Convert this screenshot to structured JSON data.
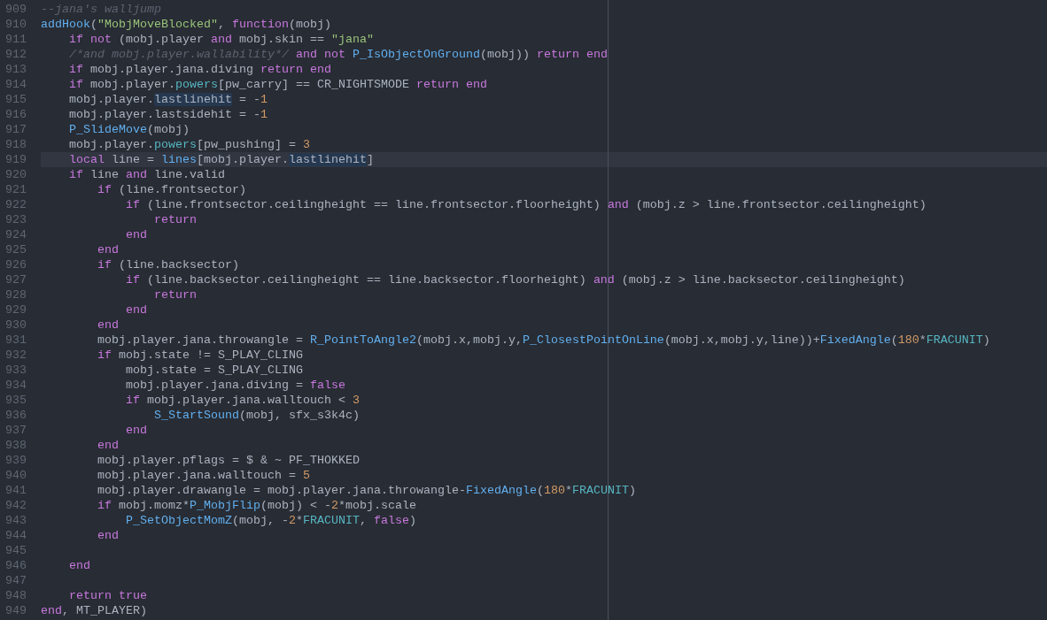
{
  "editor": {
    "lines": [
      {
        "number": "909",
        "current": false,
        "tokens": [
          {
            "text": "--jana's walljump",
            "kind": "comment"
          }
        ]
      },
      {
        "number": "910",
        "current": false,
        "tokens": [
          {
            "text": "addHook",
            "kind": "function"
          },
          {
            "text": "(",
            "kind": "plain"
          },
          {
            "text": "\"MobjMoveBlocked\"",
            "kind": "string"
          },
          {
            "text": ", ",
            "kind": "plain"
          },
          {
            "text": "function",
            "kind": "keyword"
          },
          {
            "text": "(mobj)",
            "kind": "plain"
          }
        ]
      },
      {
        "number": "911",
        "current": false,
        "tokens": [
          {
            "text": "    if ",
            "kind": "keyword"
          },
          {
            "text": "not",
            "kind": "keyword"
          },
          {
            "text": " (mobj.player ",
            "kind": "plain"
          },
          {
            "text": "and",
            "kind": "keyword"
          },
          {
            "text": " mobj.skin == ",
            "kind": "plain"
          },
          {
            "text": "\"jana\"",
            "kind": "string"
          }
        ]
      },
      {
        "number": "912",
        "current": false,
        "tokens": [
          {
            "text": "    /*and mobj.player.wallability*/ ",
            "kind": "comment"
          },
          {
            "text": "and not ",
            "kind": "keyword"
          },
          {
            "text": "P_IsObjectOnGround",
            "kind": "function"
          },
          {
            "text": "(mobj)) ",
            "kind": "plain"
          },
          {
            "text": "return end",
            "kind": "keyword"
          }
        ]
      },
      {
        "number": "913",
        "current": false,
        "tokens": [
          {
            "text": "    if",
            "kind": "keyword"
          },
          {
            "text": " mobj.player.jana.diving ",
            "kind": "plain"
          },
          {
            "text": "return end",
            "kind": "keyword"
          }
        ]
      },
      {
        "number": "914",
        "current": false,
        "tokens": [
          {
            "text": "    if",
            "kind": "keyword"
          },
          {
            "text": " mobj.player.",
            "kind": "plain"
          },
          {
            "text": "powers",
            "kind": "member"
          },
          {
            "text": "[pw_carry] == CR_NIGHTSMODE ",
            "kind": "plain"
          },
          {
            "text": "return end",
            "kind": "keyword"
          }
        ]
      },
      {
        "number": "915",
        "current": false,
        "tokens": [
          {
            "text": "    mobj.player.",
            "kind": "plain"
          },
          {
            "text": "lastlinehit",
            "kind": "match"
          },
          {
            "text": " = -",
            "kind": "plain"
          },
          {
            "text": "1",
            "kind": "number"
          }
        ]
      },
      {
        "number": "916",
        "current": false,
        "tokens": [
          {
            "text": "    mobj.player.lastsidehit = -",
            "kind": "plain"
          },
          {
            "text": "1",
            "kind": "number"
          }
        ]
      },
      {
        "number": "917",
        "current": false,
        "tokens": [
          {
            "text": "    P_SlideMove",
            "kind": "function"
          },
          {
            "text": "(mobj)",
            "kind": "plain"
          }
        ]
      },
      {
        "number": "918",
        "current": false,
        "tokens": [
          {
            "text": "    mobj.player.",
            "kind": "plain"
          },
          {
            "text": "powers",
            "kind": "member"
          },
          {
            "text": "[pw_pushing] = ",
            "kind": "plain"
          },
          {
            "text": "3",
            "kind": "number"
          }
        ]
      },
      {
        "number": "919",
        "current": true,
        "tokens": [
          {
            "text": "    local",
            "kind": "keyword"
          },
          {
            "text": " line = ",
            "kind": "plain"
          },
          {
            "text": "lines",
            "kind": "function"
          },
          {
            "text": "[mobj.player.",
            "kind": "plain"
          },
          {
            "text": "lastlinehit",
            "kind": "match"
          },
          {
            "text": "]",
            "kind": "plain"
          }
        ]
      },
      {
        "number": "920",
        "current": false,
        "tokens": [
          {
            "text": "    if",
            "kind": "keyword"
          },
          {
            "text": " line ",
            "kind": "plain"
          },
          {
            "text": "and",
            "kind": "keyword"
          },
          {
            "text": " line.valid",
            "kind": "plain"
          }
        ]
      },
      {
        "number": "921",
        "current": false,
        "tokens": [
          {
            "text": "        if",
            "kind": "keyword"
          },
          {
            "text": " (line.frontsector)",
            "kind": "plain"
          }
        ]
      },
      {
        "number": "922",
        "current": false,
        "tokens": [
          {
            "text": "            if",
            "kind": "keyword"
          },
          {
            "text": " (line.frontsector.ceilingheight == line.frontsector.floorheight) ",
            "kind": "plain"
          },
          {
            "text": "and",
            "kind": "keyword"
          },
          {
            "text": " (mobj.z > line.frontsector.ceilingheight)",
            "kind": "plain"
          }
        ]
      },
      {
        "number": "923",
        "current": false,
        "tokens": [
          {
            "text": "                return",
            "kind": "keyword"
          }
        ]
      },
      {
        "number": "924",
        "current": false,
        "tokens": [
          {
            "text": "            end",
            "kind": "keyword"
          }
        ]
      },
      {
        "number": "925",
        "current": false,
        "tokens": [
          {
            "text": "        end",
            "kind": "keyword"
          }
        ]
      },
      {
        "number": "926",
        "current": false,
        "tokens": [
          {
            "text": "        if",
            "kind": "keyword"
          },
          {
            "text": " (line.backsector)",
            "kind": "plain"
          }
        ]
      },
      {
        "number": "927",
        "current": false,
        "tokens": [
          {
            "text": "            if",
            "kind": "keyword"
          },
          {
            "text": " (line.backsector.ceilingheight == line.backsector.floorheight) ",
            "kind": "plain"
          },
          {
            "text": "and",
            "kind": "keyword"
          },
          {
            "text": " (mobj.z > line.backsector.ceilingheight)",
            "kind": "plain"
          }
        ]
      },
      {
        "number": "928",
        "current": false,
        "tokens": [
          {
            "text": "                return",
            "kind": "keyword"
          }
        ]
      },
      {
        "number": "929",
        "current": false,
        "tokens": [
          {
            "text": "            end",
            "kind": "keyword"
          }
        ]
      },
      {
        "number": "930",
        "current": false,
        "tokens": [
          {
            "text": "        end",
            "kind": "keyword"
          }
        ]
      },
      {
        "number": "931",
        "current": false,
        "tokens": [
          {
            "text": "        mobj.player.jana.throwangle = ",
            "kind": "plain"
          },
          {
            "text": "R_PointToAngle2",
            "kind": "function"
          },
          {
            "text": "(mobj.x,mobj.y,",
            "kind": "plain"
          },
          {
            "text": "P_ClosestPointOnLine",
            "kind": "function"
          },
          {
            "text": "(mobj.x,mobj.y,line))+",
            "kind": "plain"
          },
          {
            "text": "FixedAngle",
            "kind": "function"
          },
          {
            "text": "(",
            "kind": "plain"
          },
          {
            "text": "180",
            "kind": "number"
          },
          {
            "text": "*",
            "kind": "plain"
          },
          {
            "text": "FRACUNIT",
            "kind": "member"
          },
          {
            "text": ")",
            "kind": "plain"
          }
        ]
      },
      {
        "number": "932",
        "current": false,
        "tokens": [
          {
            "text": "        if",
            "kind": "keyword"
          },
          {
            "text": " mobj.state != S_PLAY_CLING",
            "kind": "plain"
          }
        ]
      },
      {
        "number": "933",
        "current": false,
        "tokens": [
          {
            "text": "            mobj.state = S_PLAY_CLING",
            "kind": "plain"
          }
        ]
      },
      {
        "number": "934",
        "current": false,
        "tokens": [
          {
            "text": "            mobj.player.jana.diving = ",
            "kind": "plain"
          },
          {
            "text": "false",
            "kind": "keyword"
          }
        ]
      },
      {
        "number": "935",
        "current": false,
        "tokens": [
          {
            "text": "            if",
            "kind": "keyword"
          },
          {
            "text": " mobj.player.jana.walltouch < ",
            "kind": "plain"
          },
          {
            "text": "3",
            "kind": "number"
          }
        ]
      },
      {
        "number": "936",
        "current": false,
        "tokens": [
          {
            "text": "                S_StartSound",
            "kind": "function"
          },
          {
            "text": "(mobj, sfx_s3k4c)",
            "kind": "plain"
          }
        ]
      },
      {
        "number": "937",
        "current": false,
        "tokens": [
          {
            "text": "            end",
            "kind": "keyword"
          }
        ]
      },
      {
        "number": "938",
        "current": false,
        "tokens": [
          {
            "text": "        end",
            "kind": "keyword"
          }
        ]
      },
      {
        "number": "939",
        "current": false,
        "tokens": [
          {
            "text": "        mobj.player.pflags = $ & ~ PF_THOKKED",
            "kind": "plain"
          }
        ]
      },
      {
        "number": "940",
        "current": false,
        "tokens": [
          {
            "text": "        mobj.player.jana.walltouch = ",
            "kind": "plain"
          },
          {
            "text": "5",
            "kind": "number"
          }
        ]
      },
      {
        "number": "941",
        "current": false,
        "tokens": [
          {
            "text": "        mobj.player.drawangle = mobj.player.jana.throwangle-",
            "kind": "plain"
          },
          {
            "text": "FixedAngle",
            "kind": "function"
          },
          {
            "text": "(",
            "kind": "plain"
          },
          {
            "text": "180",
            "kind": "number"
          },
          {
            "text": "*",
            "kind": "plain"
          },
          {
            "text": "FRACUNIT",
            "kind": "member"
          },
          {
            "text": ")",
            "kind": "plain"
          }
        ]
      },
      {
        "number": "942",
        "current": false,
        "tokens": [
          {
            "text": "        if",
            "kind": "keyword"
          },
          {
            "text": " mobj.momz*",
            "kind": "plain"
          },
          {
            "text": "P_MobjFlip",
            "kind": "function"
          },
          {
            "text": "(mobj) < -",
            "kind": "plain"
          },
          {
            "text": "2",
            "kind": "number"
          },
          {
            "text": "*mobj.scale",
            "kind": "plain"
          }
        ]
      },
      {
        "number": "943",
        "current": false,
        "tokens": [
          {
            "text": "            P_SetObjectMomZ",
            "kind": "function"
          },
          {
            "text": "(mobj, -",
            "kind": "plain"
          },
          {
            "text": "2",
            "kind": "number"
          },
          {
            "text": "*",
            "kind": "plain"
          },
          {
            "text": "FRACUNIT",
            "kind": "member"
          },
          {
            "text": ", ",
            "kind": "plain"
          },
          {
            "text": "false",
            "kind": "keyword"
          },
          {
            "text": ")",
            "kind": "plain"
          }
        ]
      },
      {
        "number": "944",
        "current": false,
        "tokens": [
          {
            "text": "        end",
            "kind": "keyword"
          }
        ]
      },
      {
        "number": "945",
        "current": false
      },
      {
        "number": "946",
        "current": false,
        "tokens": [
          {
            "text": "    end",
            "kind": "keyword"
          }
        ]
      },
      {
        "number": "947",
        "current": false
      },
      {
        "number": "948",
        "current": false,
        "tokens": [
          {
            "text": "    return true",
            "kind": "keyword"
          }
        ]
      },
      {
        "number": "949",
        "current": false,
        "tokens": [
          {
            "text": "end",
            "kind": "keyword"
          },
          {
            "text": ", MT_PLAYER)",
            "kind": "plain"
          }
        ]
      }
    ]
  }
}
